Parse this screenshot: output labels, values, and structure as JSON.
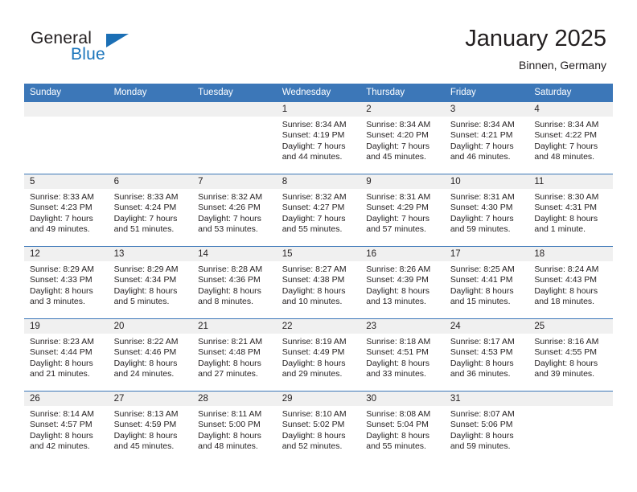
{
  "brand": {
    "name_part1": "General",
    "name_part2": "Blue",
    "flag_icon": "triangle-flag-icon"
  },
  "header": {
    "title": "January 2025",
    "location": "Binnen, Germany"
  },
  "colors": {
    "header_blue": "#3c77b8",
    "brand_blue": "#1b75bb",
    "daynum_band": "#f0f0f0",
    "text": "#231f20"
  },
  "weekday_headers": [
    "Sunday",
    "Monday",
    "Tuesday",
    "Wednesday",
    "Thursday",
    "Friday",
    "Saturday"
  ],
  "weeks": [
    [
      {
        "day": "",
        "sunrise": "",
        "sunset": "",
        "daylight_line1": "",
        "daylight_line2": ""
      },
      {
        "day": "",
        "sunrise": "",
        "sunset": "",
        "daylight_line1": "",
        "daylight_line2": ""
      },
      {
        "day": "",
        "sunrise": "",
        "sunset": "",
        "daylight_line1": "",
        "daylight_line2": ""
      },
      {
        "day": "1",
        "sunrise": "Sunrise: 8:34 AM",
        "sunset": "Sunset: 4:19 PM",
        "daylight_line1": "Daylight: 7 hours",
        "daylight_line2": "and 44 minutes."
      },
      {
        "day": "2",
        "sunrise": "Sunrise: 8:34 AM",
        "sunset": "Sunset: 4:20 PM",
        "daylight_line1": "Daylight: 7 hours",
        "daylight_line2": "and 45 minutes."
      },
      {
        "day": "3",
        "sunrise": "Sunrise: 8:34 AM",
        "sunset": "Sunset: 4:21 PM",
        "daylight_line1": "Daylight: 7 hours",
        "daylight_line2": "and 46 minutes."
      },
      {
        "day": "4",
        "sunrise": "Sunrise: 8:34 AM",
        "sunset": "Sunset: 4:22 PM",
        "daylight_line1": "Daylight: 7 hours",
        "daylight_line2": "and 48 minutes."
      }
    ],
    [
      {
        "day": "5",
        "sunrise": "Sunrise: 8:33 AM",
        "sunset": "Sunset: 4:23 PM",
        "daylight_line1": "Daylight: 7 hours",
        "daylight_line2": "and 49 minutes."
      },
      {
        "day": "6",
        "sunrise": "Sunrise: 8:33 AM",
        "sunset": "Sunset: 4:24 PM",
        "daylight_line1": "Daylight: 7 hours",
        "daylight_line2": "and 51 minutes."
      },
      {
        "day": "7",
        "sunrise": "Sunrise: 8:32 AM",
        "sunset": "Sunset: 4:26 PM",
        "daylight_line1": "Daylight: 7 hours",
        "daylight_line2": "and 53 minutes."
      },
      {
        "day": "8",
        "sunrise": "Sunrise: 8:32 AM",
        "sunset": "Sunset: 4:27 PM",
        "daylight_line1": "Daylight: 7 hours",
        "daylight_line2": "and 55 minutes."
      },
      {
        "day": "9",
        "sunrise": "Sunrise: 8:31 AM",
        "sunset": "Sunset: 4:29 PM",
        "daylight_line1": "Daylight: 7 hours",
        "daylight_line2": "and 57 minutes."
      },
      {
        "day": "10",
        "sunrise": "Sunrise: 8:31 AM",
        "sunset": "Sunset: 4:30 PM",
        "daylight_line1": "Daylight: 7 hours",
        "daylight_line2": "and 59 minutes."
      },
      {
        "day": "11",
        "sunrise": "Sunrise: 8:30 AM",
        "sunset": "Sunset: 4:31 PM",
        "daylight_line1": "Daylight: 8 hours",
        "daylight_line2": "and 1 minute."
      }
    ],
    [
      {
        "day": "12",
        "sunrise": "Sunrise: 8:29 AM",
        "sunset": "Sunset: 4:33 PM",
        "daylight_line1": "Daylight: 8 hours",
        "daylight_line2": "and 3 minutes."
      },
      {
        "day": "13",
        "sunrise": "Sunrise: 8:29 AM",
        "sunset": "Sunset: 4:34 PM",
        "daylight_line1": "Daylight: 8 hours",
        "daylight_line2": "and 5 minutes."
      },
      {
        "day": "14",
        "sunrise": "Sunrise: 8:28 AM",
        "sunset": "Sunset: 4:36 PM",
        "daylight_line1": "Daylight: 8 hours",
        "daylight_line2": "and 8 minutes."
      },
      {
        "day": "15",
        "sunrise": "Sunrise: 8:27 AM",
        "sunset": "Sunset: 4:38 PM",
        "daylight_line1": "Daylight: 8 hours",
        "daylight_line2": "and 10 minutes."
      },
      {
        "day": "16",
        "sunrise": "Sunrise: 8:26 AM",
        "sunset": "Sunset: 4:39 PM",
        "daylight_line1": "Daylight: 8 hours",
        "daylight_line2": "and 13 minutes."
      },
      {
        "day": "17",
        "sunrise": "Sunrise: 8:25 AM",
        "sunset": "Sunset: 4:41 PM",
        "daylight_line1": "Daylight: 8 hours",
        "daylight_line2": "and 15 minutes."
      },
      {
        "day": "18",
        "sunrise": "Sunrise: 8:24 AM",
        "sunset": "Sunset: 4:43 PM",
        "daylight_line1": "Daylight: 8 hours",
        "daylight_line2": "and 18 minutes."
      }
    ],
    [
      {
        "day": "19",
        "sunrise": "Sunrise: 8:23 AM",
        "sunset": "Sunset: 4:44 PM",
        "daylight_line1": "Daylight: 8 hours",
        "daylight_line2": "and 21 minutes."
      },
      {
        "day": "20",
        "sunrise": "Sunrise: 8:22 AM",
        "sunset": "Sunset: 4:46 PM",
        "daylight_line1": "Daylight: 8 hours",
        "daylight_line2": "and 24 minutes."
      },
      {
        "day": "21",
        "sunrise": "Sunrise: 8:21 AM",
        "sunset": "Sunset: 4:48 PM",
        "daylight_line1": "Daylight: 8 hours",
        "daylight_line2": "and 27 minutes."
      },
      {
        "day": "22",
        "sunrise": "Sunrise: 8:19 AM",
        "sunset": "Sunset: 4:49 PM",
        "daylight_line1": "Daylight: 8 hours",
        "daylight_line2": "and 29 minutes."
      },
      {
        "day": "23",
        "sunrise": "Sunrise: 8:18 AM",
        "sunset": "Sunset: 4:51 PM",
        "daylight_line1": "Daylight: 8 hours",
        "daylight_line2": "and 33 minutes."
      },
      {
        "day": "24",
        "sunrise": "Sunrise: 8:17 AM",
        "sunset": "Sunset: 4:53 PM",
        "daylight_line1": "Daylight: 8 hours",
        "daylight_line2": "and 36 minutes."
      },
      {
        "day": "25",
        "sunrise": "Sunrise: 8:16 AM",
        "sunset": "Sunset: 4:55 PM",
        "daylight_line1": "Daylight: 8 hours",
        "daylight_line2": "and 39 minutes."
      }
    ],
    [
      {
        "day": "26",
        "sunrise": "Sunrise: 8:14 AM",
        "sunset": "Sunset: 4:57 PM",
        "daylight_line1": "Daylight: 8 hours",
        "daylight_line2": "and 42 minutes."
      },
      {
        "day": "27",
        "sunrise": "Sunrise: 8:13 AM",
        "sunset": "Sunset: 4:59 PM",
        "daylight_line1": "Daylight: 8 hours",
        "daylight_line2": "and 45 minutes."
      },
      {
        "day": "28",
        "sunrise": "Sunrise: 8:11 AM",
        "sunset": "Sunset: 5:00 PM",
        "daylight_line1": "Daylight: 8 hours",
        "daylight_line2": "and 48 minutes."
      },
      {
        "day": "29",
        "sunrise": "Sunrise: 8:10 AM",
        "sunset": "Sunset: 5:02 PM",
        "daylight_line1": "Daylight: 8 hours",
        "daylight_line2": "and 52 minutes."
      },
      {
        "day": "30",
        "sunrise": "Sunrise: 8:08 AM",
        "sunset": "Sunset: 5:04 PM",
        "daylight_line1": "Daylight: 8 hours",
        "daylight_line2": "and 55 minutes."
      },
      {
        "day": "31",
        "sunrise": "Sunrise: 8:07 AM",
        "sunset": "Sunset: 5:06 PM",
        "daylight_line1": "Daylight: 8 hours",
        "daylight_line2": "and 59 minutes."
      },
      {
        "day": "",
        "sunrise": "",
        "sunset": "",
        "daylight_line1": "",
        "daylight_line2": ""
      }
    ]
  ]
}
